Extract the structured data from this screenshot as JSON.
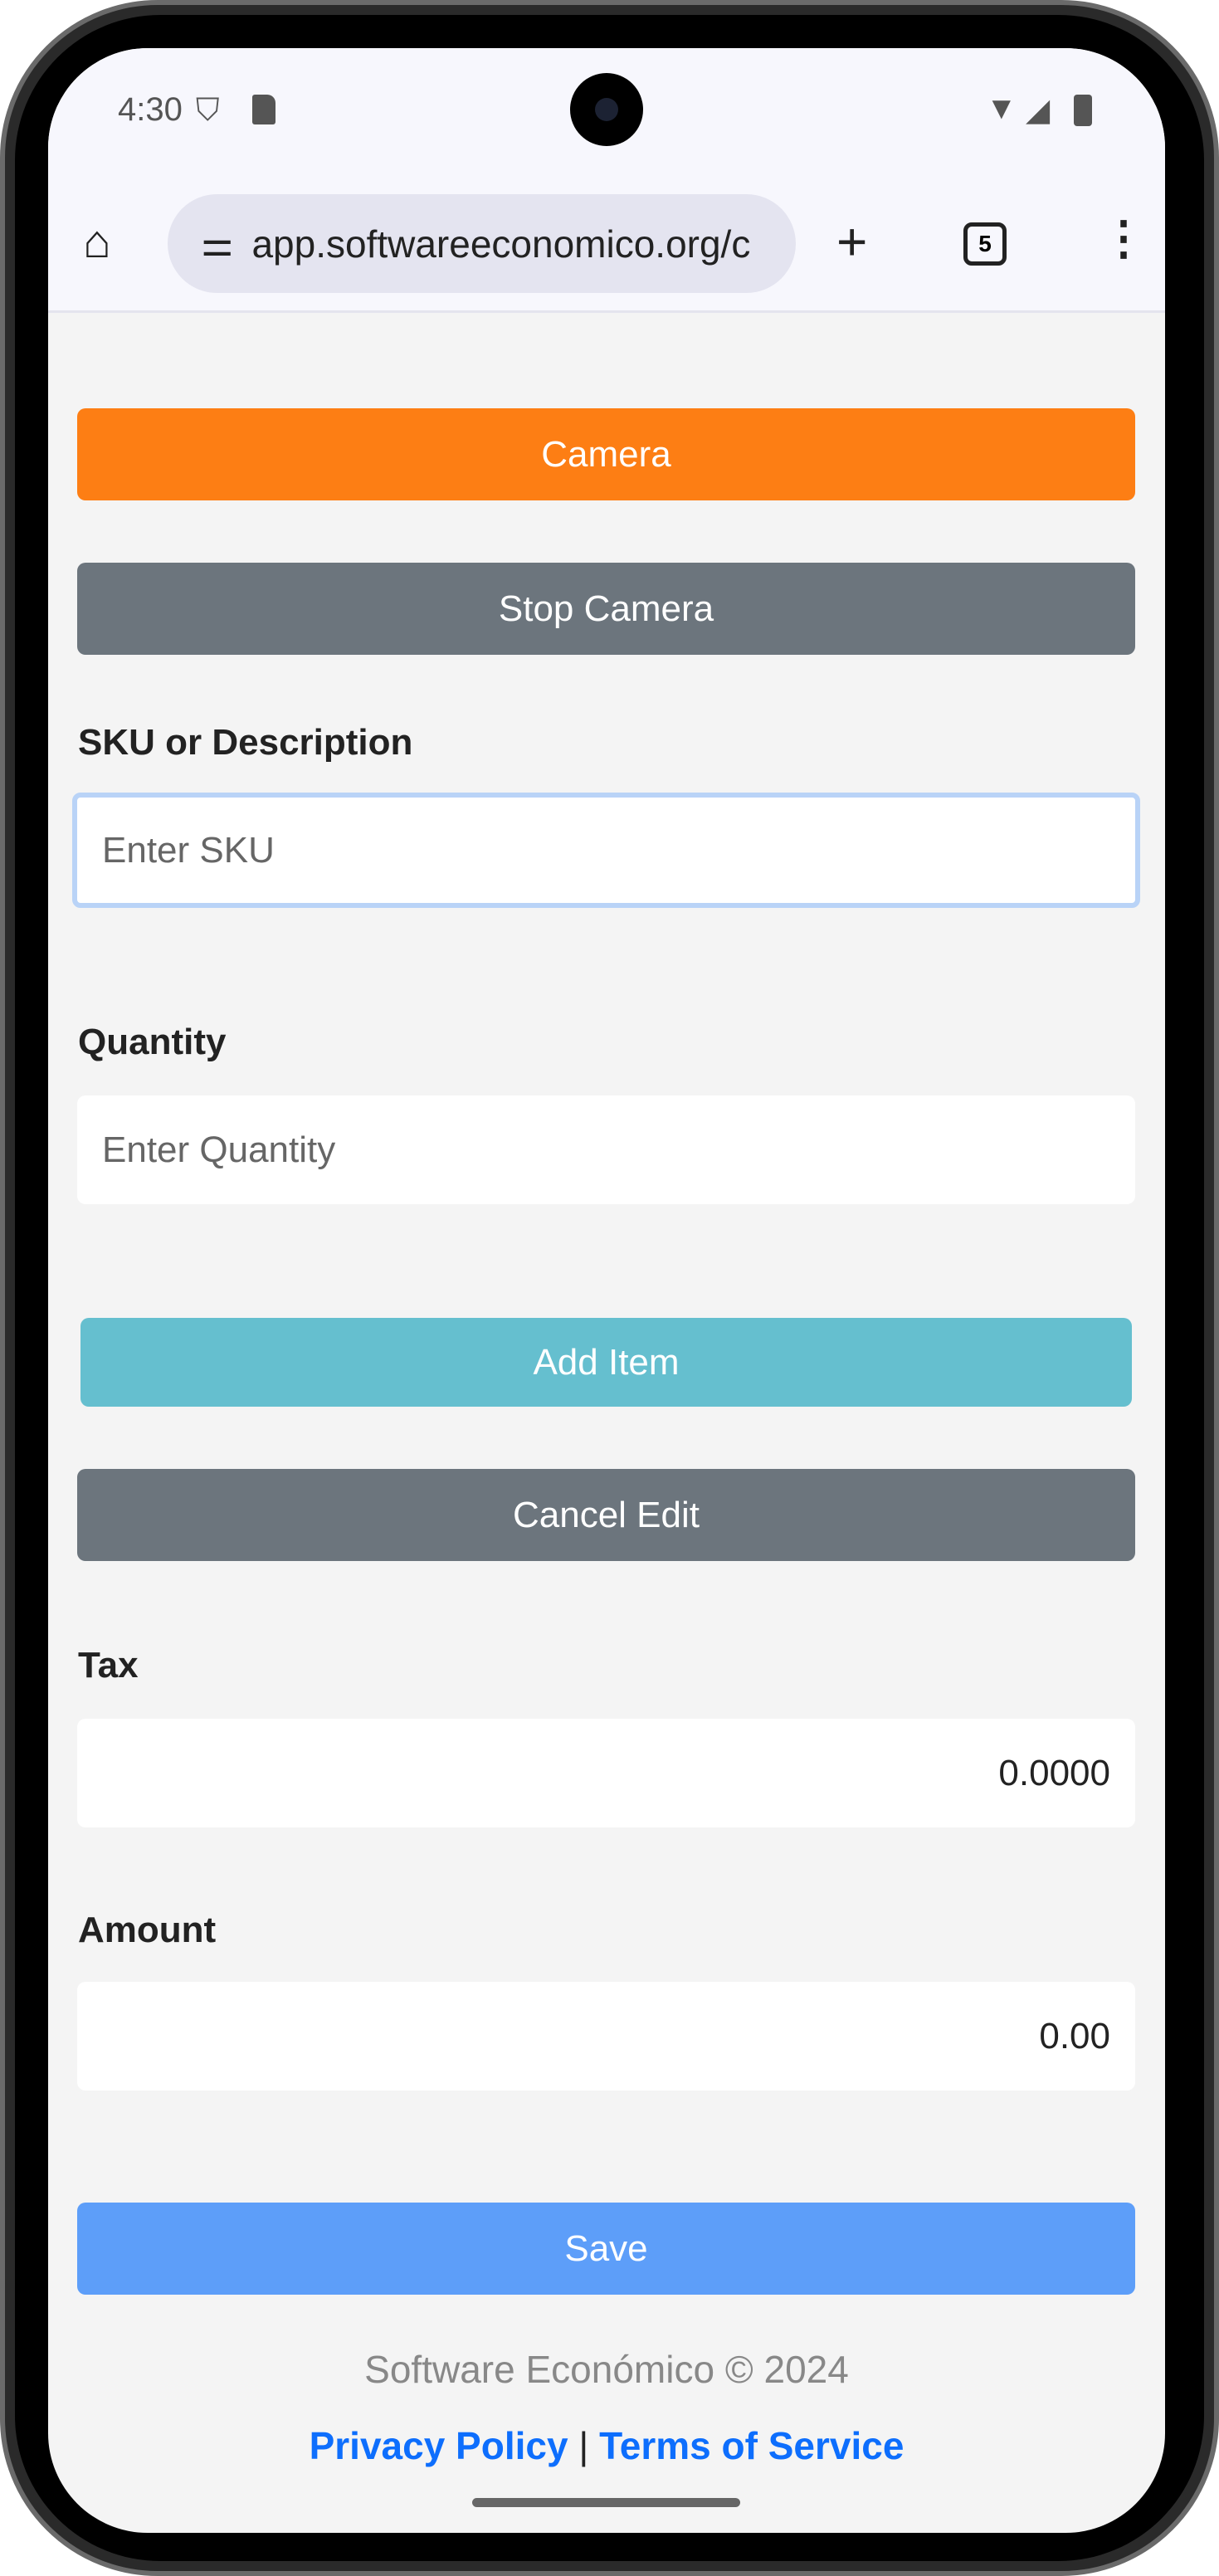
{
  "status_bar": {
    "time": "4:30",
    "icons": [
      "shield-icon",
      "sd-card-icon",
      "wifi-icon",
      "signal-icon",
      "battery-icon"
    ]
  },
  "browser": {
    "url": "app.softwareeconomico.org/c",
    "tab_count": "5"
  },
  "buttons": {
    "camera": "Camera",
    "stop_camera": "Stop Camera",
    "add_item": "Add Item",
    "cancel_edit": "Cancel Edit",
    "save": "Save"
  },
  "fields": {
    "sku": {
      "label": "SKU or Description",
      "placeholder": "Enter SKU"
    },
    "quantity": {
      "label": "Quantity",
      "placeholder": "Enter Quantity"
    },
    "tax": {
      "label": "Tax",
      "value": "0.0000"
    },
    "amount": {
      "label": "Amount",
      "value": "0.00"
    }
  },
  "footer": {
    "copyright": "Software Económico © 2024",
    "privacy": "Privacy Policy",
    "separator": "|",
    "terms": "Terms of Service"
  },
  "colors": {
    "camera": "#fd7e14",
    "secondary": "#6c757d",
    "add_item": "#65bfcf",
    "save": "#5d9ef9",
    "link": "#0d6efd"
  }
}
